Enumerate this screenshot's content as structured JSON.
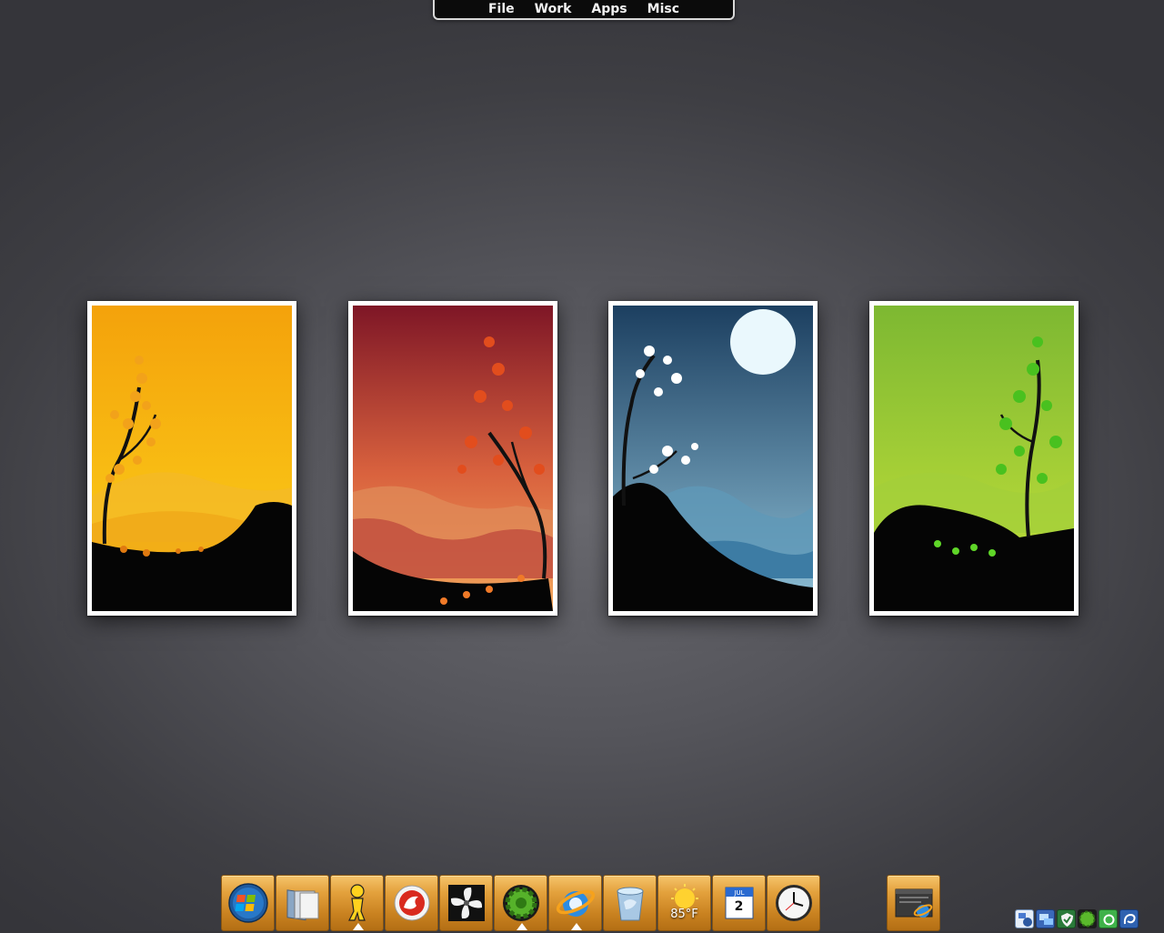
{
  "menu": {
    "items": [
      "File",
      "Work",
      "Apps",
      "Misc"
    ]
  },
  "wallpapers": [
    {
      "name": "autumn-yellow",
      "sky_top": "#f4a20b",
      "sky_bottom": "#fbd11a"
    },
    {
      "name": "autumn-red",
      "sky_top": "#7e1626",
      "sky_bottom": "#f3a75c"
    },
    {
      "name": "winter-night",
      "sky_top": "#1c3f60",
      "sky_bottom": "#8fc1d8"
    },
    {
      "name": "spring-green",
      "sky_top": "#7db832",
      "sky_bottom": "#c6e23a"
    }
  ],
  "dock": {
    "items": [
      {
        "icon": "windows-start-icon"
      },
      {
        "icon": "folders-icon"
      },
      {
        "icon": "aim-buddy-icon",
        "running": true
      },
      {
        "icon": "firefox-icon"
      },
      {
        "icon": "fan-icon"
      },
      {
        "icon": "gear-icon",
        "running": true
      },
      {
        "icon": "internet-explorer-icon",
        "running": true
      },
      {
        "icon": "recycle-bin-icon"
      },
      {
        "icon": "weather-sun-icon",
        "label": "85°F"
      },
      {
        "icon": "calendar-icon",
        "month": "JUL",
        "label": "2"
      },
      {
        "icon": "clock-icon"
      }
    ],
    "single": {
      "icon": "ie-window-icon"
    }
  },
  "tray": {
    "icons": [
      "network-icon",
      "monitor-icon",
      "shield-icon",
      "green-orb-icon",
      "green-square-icon",
      "blue-swirl-icon"
    ]
  }
}
